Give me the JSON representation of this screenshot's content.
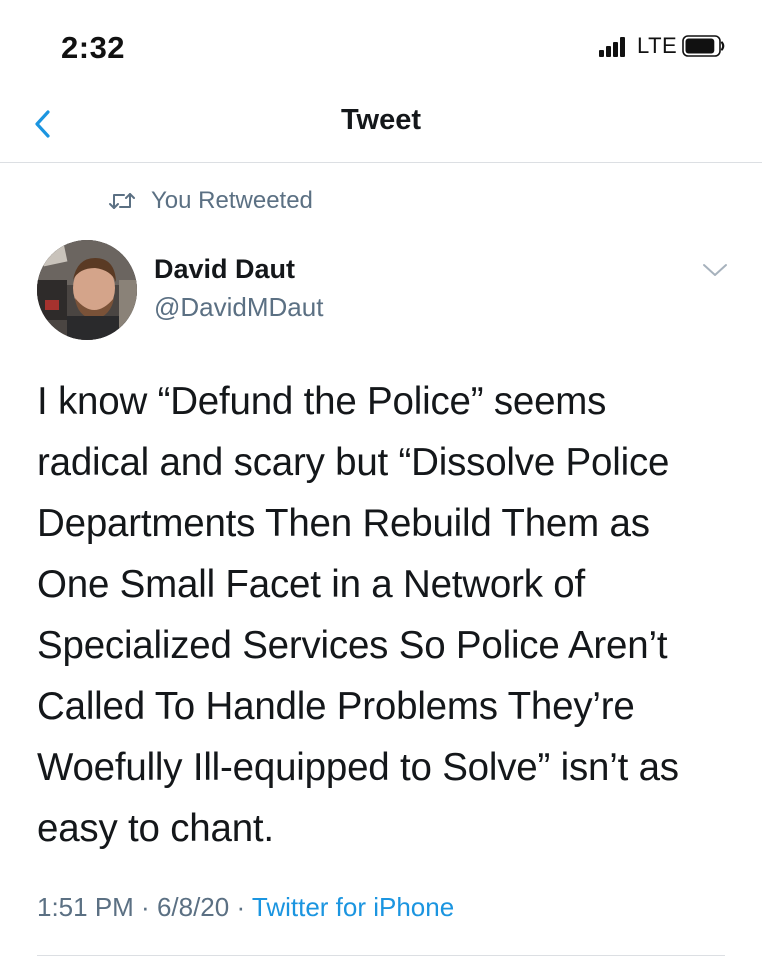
{
  "status_bar": {
    "time": "2:32",
    "network": "LTE",
    "signal_bars": 4,
    "battery_level": 0.9
  },
  "header": {
    "title": "Tweet",
    "back_icon": "chevron-left-icon"
  },
  "retweet_context": {
    "icon": "retweet-icon",
    "text": "You Retweeted"
  },
  "author": {
    "name": "David Daut",
    "handle": "@DavidMDaut",
    "more_icon": "chevron-down-icon"
  },
  "tweet": {
    "text": "I know “Defund the Police” seems\nradical and scary but “Dissolve Police\nDepartments Then Rebuild Them as\nOne Small Facet in a Network of\nSpecialized Services So Police Aren’t\nCalled To Handle Problems They’re\nWoefully Ill-equipped to Solve” isn’t as\neasy to chant.",
    "time": "1:51 PM",
    "date": "6/8/20",
    "source": "Twitter for iPhone",
    "separator": " · "
  },
  "colors": {
    "accent": "#1b95e0",
    "secondary_text": "#5b7083",
    "primary_text": "#14171a",
    "divider": "#dcdfe3"
  }
}
